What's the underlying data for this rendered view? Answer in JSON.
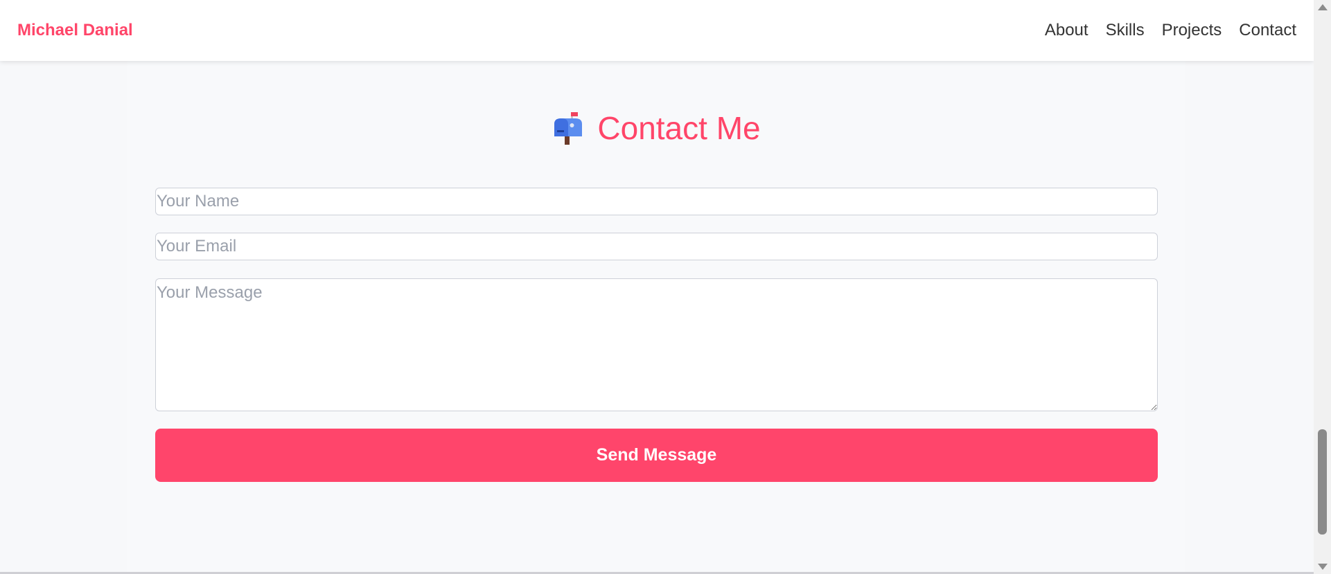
{
  "navbar": {
    "brand": "Michael Danial",
    "links": [
      "About",
      "Skills",
      "Projects",
      "Contact"
    ]
  },
  "contact": {
    "icon": "mailbox-icon",
    "title": "Contact Me",
    "name_placeholder": "Your Name",
    "email_placeholder": "Your Email",
    "message_placeholder": "Your Message",
    "submit_label": "Send Message"
  },
  "colors": {
    "accent": "#ff4569",
    "page_background": "#f8f9fb",
    "nav_text": "#333333"
  }
}
